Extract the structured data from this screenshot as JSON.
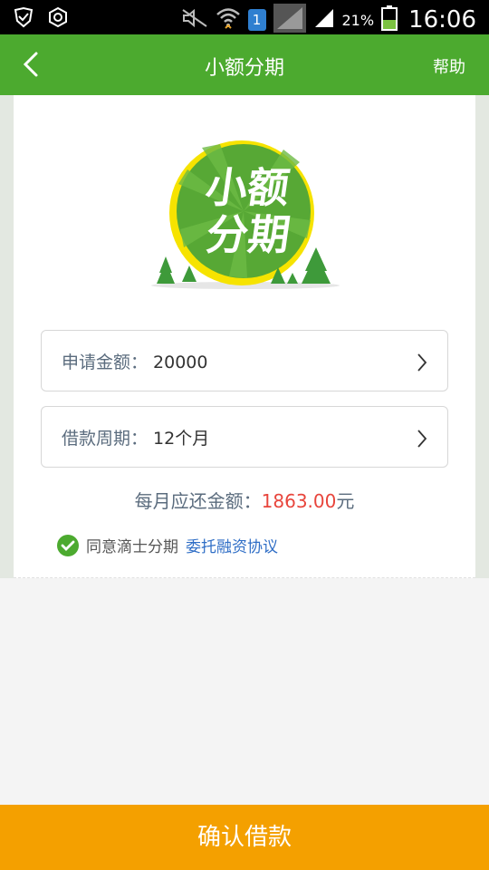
{
  "status_bar": {
    "battery_percent": "21%",
    "time": "16:06",
    "sim_number": "1"
  },
  "header": {
    "title": "小额分期",
    "help_label": "帮助"
  },
  "logo": {
    "line1": "小额",
    "line2": "分期"
  },
  "form": {
    "amount_label": "申请金额：",
    "amount_value": "20000",
    "period_label": "借款周期：",
    "period_value": "12个月"
  },
  "monthly": {
    "prefix": "每月应还金额：",
    "amount": "1863.00",
    "suffix": "元"
  },
  "agreement": {
    "text": "同意滴士分期",
    "link": "委托融资协议",
    "checked": true
  },
  "confirm_label": "确认借款",
  "colors": {
    "header_green": "#4caa2f",
    "confirm_orange": "#f4a000",
    "amount_red": "#e8453c",
    "link_blue": "#2f6ec6"
  }
}
